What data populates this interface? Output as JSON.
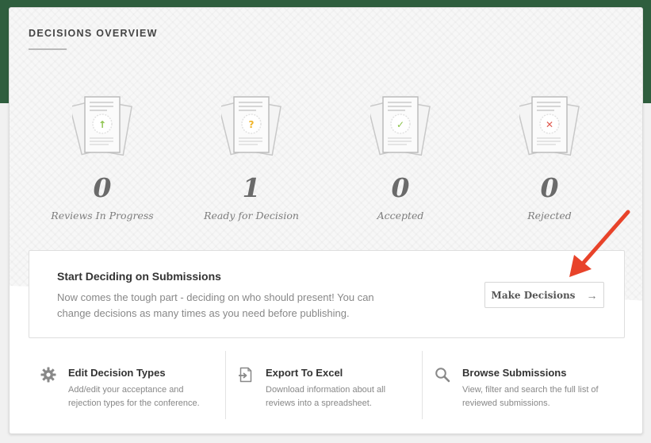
{
  "card": {
    "title": "DECISIONS OVERVIEW"
  },
  "stats": [
    {
      "count": "0",
      "label": "Reviews In Progress",
      "symbol": "↑",
      "icon": "arrow-up-icon",
      "color": "#8bc34a"
    },
    {
      "count": "1",
      "label": "Ready for Decision",
      "symbol": "?",
      "icon": "question-icon",
      "color": "#f0b429"
    },
    {
      "count": "0",
      "label": "Accepted",
      "symbol": "✓",
      "icon": "check-icon",
      "color": "#8bc34a"
    },
    {
      "count": "0",
      "label": "Rejected",
      "symbol": "✕",
      "icon": "x-icon",
      "color": "#e05a4f"
    }
  ],
  "cta": {
    "title": "Start Deciding on Submissions",
    "description": "Now comes the tough part - deciding on who should present! You can change decisions as many times as you need before publishing.",
    "button_label": "Make Decisions",
    "button_icon": "→"
  },
  "actions": [
    {
      "title": "Edit Decision Types",
      "description": "Add/edit your acceptance and rejection types for the conference.",
      "icon": "gear-icon"
    },
    {
      "title": "Export To Excel",
      "description": "Download information about all reviews into a spreadsheet.",
      "icon": "export-icon"
    },
    {
      "title": "Browse Submissions",
      "description": "View, filter and search the full list of reviewed submissions.",
      "icon": "search-icon"
    }
  ],
  "colors": {
    "header_green": "#2f5e3e",
    "annotation_arrow": "#e8432a"
  }
}
